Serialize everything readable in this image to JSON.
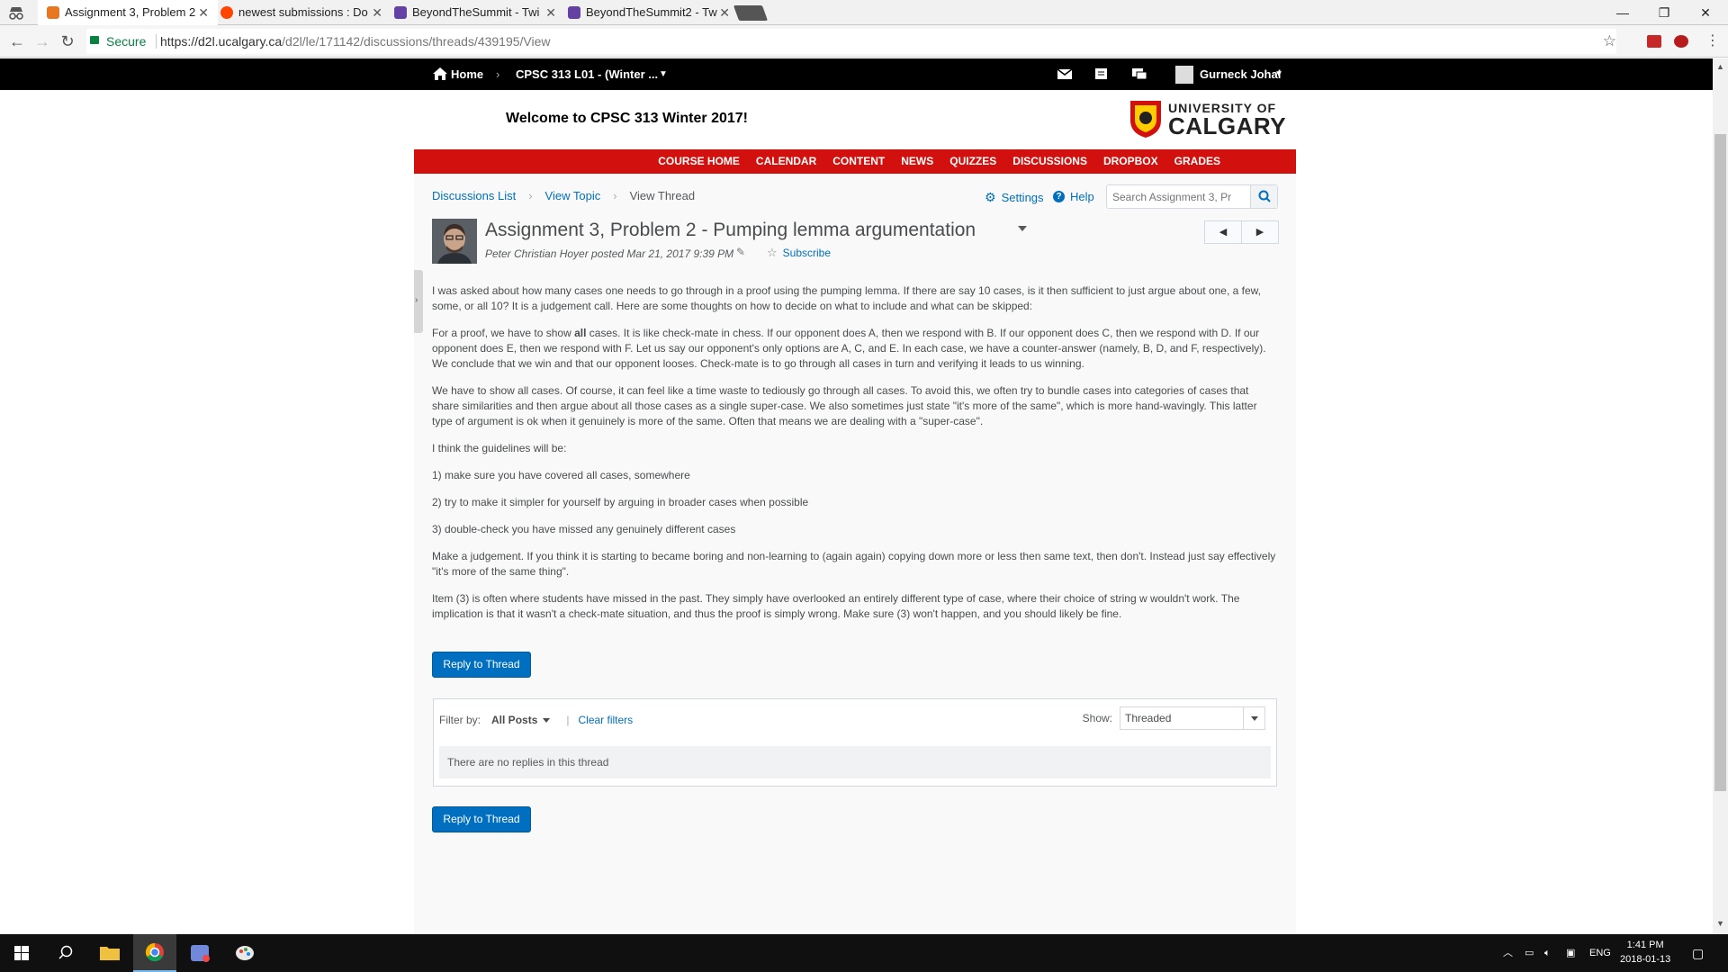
{
  "browser": {
    "tabs": [
      {
        "title": "Assignment 3, Problem 2",
        "active": true
      },
      {
        "title": "newest submissions : Do",
        "active": false
      },
      {
        "title": "BeyondTheSummit - Twi",
        "active": false
      },
      {
        "title": "BeyondTheSummit2 - Tw",
        "active": false
      }
    ],
    "secure_label": "Secure",
    "url_host": "https://d2l.ucalgary.ca",
    "url_path": "/d2l/le/171142/discussions/threads/439195/View"
  },
  "minibar": {
    "home": "Home",
    "course": "CPSC 313 L01 - (Winter ...",
    "user": "Gurneck Johal"
  },
  "header": {
    "welcome": "Welcome to CPSC 313 Winter 2017!",
    "logo_line1": "UNIVERSITY OF",
    "logo_line2": "CALGARY"
  },
  "nav": [
    "COURSE HOME",
    "CALENDAR",
    "CONTENT",
    "NEWS",
    "QUIZZES",
    "DISCUSSIONS",
    "DROPBOX",
    "GRADES"
  ],
  "breadcrumbs": {
    "list": "Discussions List",
    "topic": "View Topic",
    "current": "View Thread"
  },
  "tools": {
    "settings": "Settings",
    "help": "Help",
    "search_placeholder": "Search Assignment 3, Pr"
  },
  "thread": {
    "title": "Assignment 3, Problem 2 - Pumping lemma argumentation",
    "meta": "Peter Christian Hoyer posted Mar 21, 2017 9:39 PM",
    "subscribe": "Subscribe",
    "p1": "I was asked about how many cases one needs to go through in a proof using the pumping lemma. If there are say 10 cases, is it then sufficient to just argue about one, a few, some, or all 10? It is a judgement call. Here are some thoughts on how to decide on what to include and what can be skipped:",
    "p2_a": "For a proof, we have to show ",
    "p2_bold": "all",
    "p2_b": " cases. It is like check-mate in chess. If our opponent does A, then we respond with B. If our opponent does C, then we respond with D. If our opponent does E, then we respond with F. Let us say our opponent's only options are A, C, and E. In each case, we have a counter-answer (namely, B, D, and F, respectively). We conclude that we win and that our opponent looses. Check-mate is to go through all cases in turn and verifying it leads to us winning.",
    "p3": "We have to show all cases. Of course, it can feel like a time waste to tediously go through all cases. To avoid this, we often try to bundle cases into categories of cases that share similarities and then argue about all those cases as a single super-case. We also sometimes just state \"it's more of the same\", which is more hand-wavingly. This latter type of argument is ok when it genuinely is more of the same. Often that means we are dealing with a \"super-case\".",
    "p4": "I think the guidelines will be:",
    "g1": "1) make sure you have covered all cases, somewhere",
    "g2": "2) try to make it simpler for yourself by arguing in broader cases when possible",
    "g3": "3) double-check you have missed any genuinely different cases",
    "p5": "Make a judgement. If you think it is starting to became boring and non-learning to (again again) copying down more or less then same text, then don't. Instead just say effectively \"it's more of the same thing\".",
    "p6": "Item (3) is often where students have missed in the past. They simply have overlooked an entirely different type of case, where their choice of string w wouldn't work. The implication is that it wasn't a check-mate situation, and thus the proof is simply wrong. Make sure (3) won't happen, and you should likely be fine."
  },
  "reply_button": "Reply to Thread",
  "replies": {
    "filter_label": "Filter by:",
    "filter_value": "All Posts",
    "clear": "Clear filters",
    "show_label": "Show:",
    "show_value": "Threaded",
    "empty": "There are no replies in this thread"
  },
  "taskbar": {
    "lang": "ENG",
    "time": "1:41 PM",
    "date": "2018-01-13"
  },
  "colors": {
    "nav_red": "#d2110e",
    "link_blue": "#006fbf",
    "button_blue": "#006fbf"
  }
}
